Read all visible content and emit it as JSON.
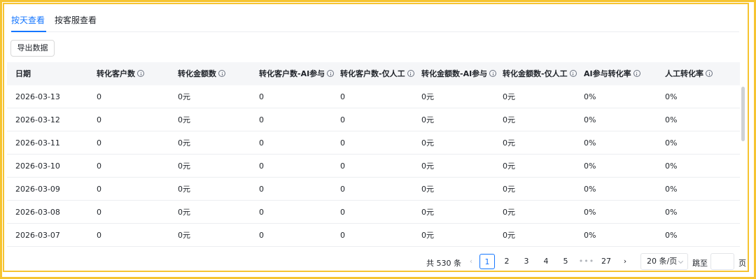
{
  "tabs": [
    {
      "label": "按天查看",
      "active": true
    },
    {
      "label": "按客服查看",
      "active": false
    }
  ],
  "toolbar": {
    "export_label": "导出数据"
  },
  "table": {
    "columns": [
      {
        "label": "日期",
        "info": false
      },
      {
        "label": "转化客户数",
        "info": true
      },
      {
        "label": "转化金额数",
        "info": true
      },
      {
        "label": "转化客户数-AI参与",
        "info": true
      },
      {
        "label": "转化客户数-仅人工",
        "info": true
      },
      {
        "label": "转化金额数-AI参与",
        "info": true
      },
      {
        "label": "转化金额数-仅人工",
        "info": true
      },
      {
        "label": "AI参与转化率",
        "info": true
      },
      {
        "label": "人工转化率",
        "info": true
      }
    ],
    "rows": [
      [
        "2026-03-13",
        "0",
        "0元",
        "0",
        "0",
        "0元",
        "0元",
        "0%",
        "0%"
      ],
      [
        "2026-03-12",
        "0",
        "0元",
        "0",
        "0",
        "0元",
        "0元",
        "0%",
        "0%"
      ],
      [
        "2026-03-11",
        "0",
        "0元",
        "0",
        "0",
        "0元",
        "0元",
        "0%",
        "0%"
      ],
      [
        "2026-03-10",
        "0",
        "0元",
        "0",
        "0",
        "0元",
        "0元",
        "0%",
        "0%"
      ],
      [
        "2026-03-09",
        "0",
        "0元",
        "0",
        "0",
        "0元",
        "0元",
        "0%",
        "0%"
      ],
      [
        "2026-03-08",
        "0",
        "0元",
        "0",
        "0",
        "0元",
        "0元",
        "0%",
        "0%"
      ],
      [
        "2026-03-07",
        "0",
        "0元",
        "0",
        "0",
        "0元",
        "0元",
        "0%",
        "0%"
      ]
    ]
  },
  "pagination": {
    "total_text": "共 530 条",
    "pages": [
      "1",
      "2",
      "3",
      "4",
      "5"
    ],
    "ellipsis": "•••",
    "last_page": "27",
    "current_page": "1",
    "page_size_label": "20 条/页",
    "jump_label": "跳至",
    "jump_value": "",
    "jump_unit": "页"
  },
  "colors": {
    "accent": "#1677ff",
    "frame": "#f6c431",
    "header_bg": "#f5f6f8"
  }
}
